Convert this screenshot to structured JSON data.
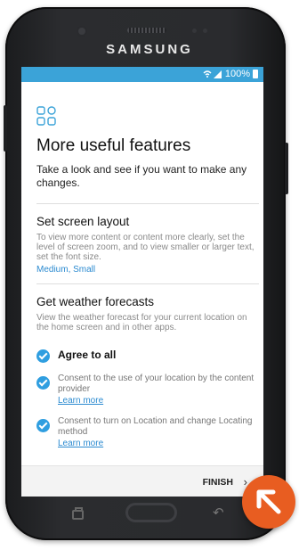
{
  "device": {
    "brand": "SAMSUNG"
  },
  "statusbar": {
    "signal_icon": "wifi-signal-icon",
    "battery": "100%"
  },
  "page": {
    "feature_icon": "grid-icon",
    "title": "More useful features",
    "subtitle": "Take a look and see if you want to make any changes."
  },
  "sections": [
    {
      "title": "Set screen layout",
      "desc": "To view more content or content more clearly, set the level of screen zoom, and to view smaller or larger text, set the font size.",
      "value": "Medium, Small"
    },
    {
      "title": "Get weather forecasts",
      "desc": "View the weather forecast for your current location on the home screen and in other apps."
    }
  ],
  "consents": {
    "agree_all": "Agree to all",
    "items": [
      {
        "text": "Consent to the use of your location by the content provider",
        "link": "Learn more"
      },
      {
        "text": "Consent to turn on Location and change Locating method",
        "link": "Learn more"
      }
    ]
  },
  "footer": {
    "finish": "FINISH"
  },
  "colors": {
    "accent": "#3ba3d8",
    "checkbox": "#2f9ee0",
    "link": "#2a8ad0",
    "badge": "#e85d21"
  }
}
